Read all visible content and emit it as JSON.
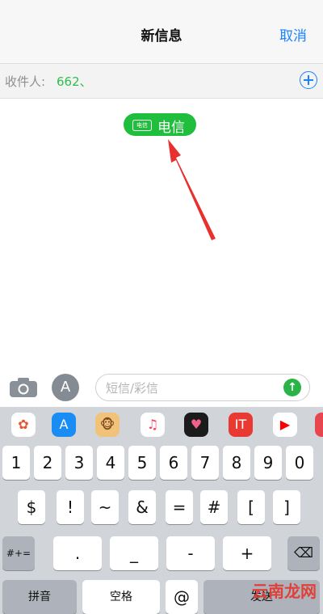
{
  "nav": {
    "title": "新信息",
    "cancel": "取消"
  },
  "recipient": {
    "label": "收件人:",
    "value": "662、"
  },
  "carrier_chip": {
    "tag": "电信",
    "label": "电信"
  },
  "composer": {
    "placeholder": "短信/彩信"
  },
  "app_strip": [
    {
      "name": "photos",
      "glyph": "✿",
      "bg": "#ffffff",
      "color": "#e4572e"
    },
    {
      "name": "app-store",
      "glyph": "A",
      "bg": "#1a8df5",
      "color": "#ffffff"
    },
    {
      "name": "animoji",
      "glyph": "🐵",
      "bg": "#f0c27a",
      "color": "#7a4a1e"
    },
    {
      "name": "music",
      "glyph": "♫",
      "bg": "#ffffff",
      "color": "#fb3c5a"
    },
    {
      "name": "digital-touch",
      "glyph": "♥",
      "bg": "#1b1b1b",
      "color": "#f0608a"
    },
    {
      "name": "it-home",
      "glyph": "IT",
      "bg": "#e83a32",
      "color": "#ffffff"
    },
    {
      "name": "youtube",
      "glyph": "▶",
      "bg": "#ffffff",
      "color": "#ff0000"
    },
    {
      "name": "app-more",
      "glyph": "",
      "bg": "#e8464f",
      "color": "#ffffff"
    }
  ],
  "keyboard": {
    "row1": [
      "1",
      "2",
      "3",
      "4",
      "5",
      "6",
      "7",
      "8",
      "9",
      "0"
    ],
    "row2": [
      "$",
      "!",
      "~",
      "&",
      "=",
      "#",
      "[",
      "]"
    ],
    "row3": [
      "#+=",
      ".",
      "_",
      "-",
      "+",
      "⌫"
    ],
    "row4": [
      "拼音",
      "空格",
      "@",
      "发送"
    ]
  },
  "watermark": "云南龙网"
}
